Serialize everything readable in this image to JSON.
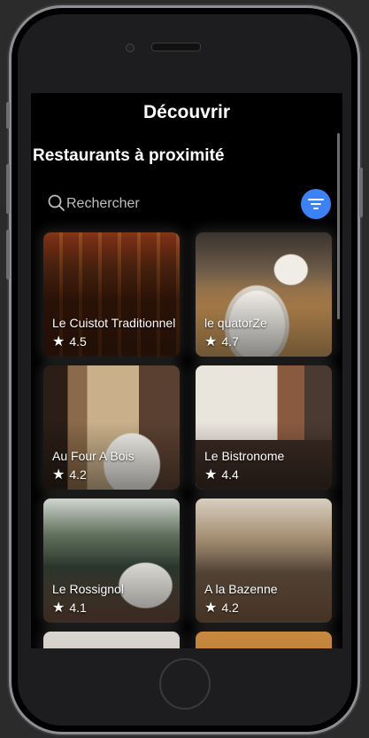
{
  "header": {
    "title": "Découvrir"
  },
  "section": {
    "title": "Restaurants à proximité"
  },
  "search": {
    "placeholder": "Rechercher",
    "value": ""
  },
  "colors": {
    "accent": "#3b82f6",
    "background": "#000000",
    "text": "#ffffff"
  },
  "restaurants": [
    {
      "name": "Le Cuistot Traditionnel",
      "rating": "4.5"
    },
    {
      "name": "le quatorZe",
      "rating": "4.7"
    },
    {
      "name": "Au Four A Bois",
      "rating": "4.2"
    },
    {
      "name": "Le Bistronome",
      "rating": "4.4"
    },
    {
      "name": "Le Rossignol",
      "rating": "4.1"
    },
    {
      "name": "A la Bazenne",
      "rating": "4.2"
    }
  ],
  "icons": {
    "search": "search-icon",
    "filter": "filter-icon",
    "star": "star-icon"
  }
}
